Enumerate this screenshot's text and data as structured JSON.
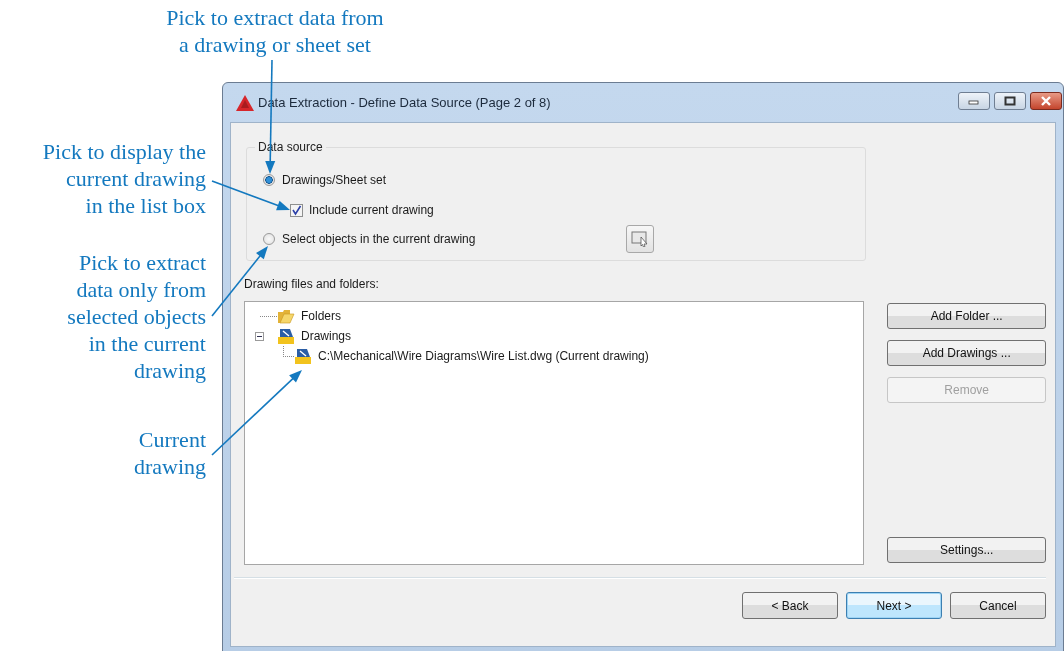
{
  "callouts": [
    {
      "text": "Pick to extract data from\na drawing or sheet set"
    },
    {
      "text": "Pick to display the\ncurrent drawing\nin the list box"
    },
    {
      "text": "Pick to extract\ndata only from\nselected objects\nin the current\ndrawing"
    },
    {
      "text": "Current\ndrawing"
    }
  ],
  "window": {
    "title": "Data Extraction - Define Data Source (Page 2 of 8)"
  },
  "data_source": {
    "legend": "Data source",
    "options": [
      {
        "kind": "radio",
        "label": "Drawings/Sheet set",
        "selected": true
      },
      {
        "kind": "checkbox",
        "label": "Include current drawing",
        "checked": true
      },
      {
        "kind": "radio",
        "label": "Select objects in the current drawing",
        "selected": false
      }
    ]
  },
  "files": {
    "label": "Drawing files and folders:",
    "tree": [
      {
        "kind": "folder",
        "label": "Folders"
      },
      {
        "kind": "drawings",
        "label": "Drawings",
        "expanded": true,
        "children": [
          {
            "kind": "drawing",
            "label": "C:\\Mechanical\\Wire Diagrams\\Wire List.dwg (Current drawing)"
          }
        ]
      }
    ]
  },
  "side_buttons": [
    {
      "label": "Add Folder ...",
      "disabled": false
    },
    {
      "label": "Add Drawings ...",
      "disabled": false
    },
    {
      "label": "Remove",
      "disabled": true
    },
    {
      "label": "Settings...",
      "disabled": false
    }
  ],
  "footer_buttons": [
    {
      "label": "< Back",
      "default": false
    },
    {
      "label": "Next >",
      "default": true
    },
    {
      "label": "Cancel",
      "default": false
    }
  ]
}
